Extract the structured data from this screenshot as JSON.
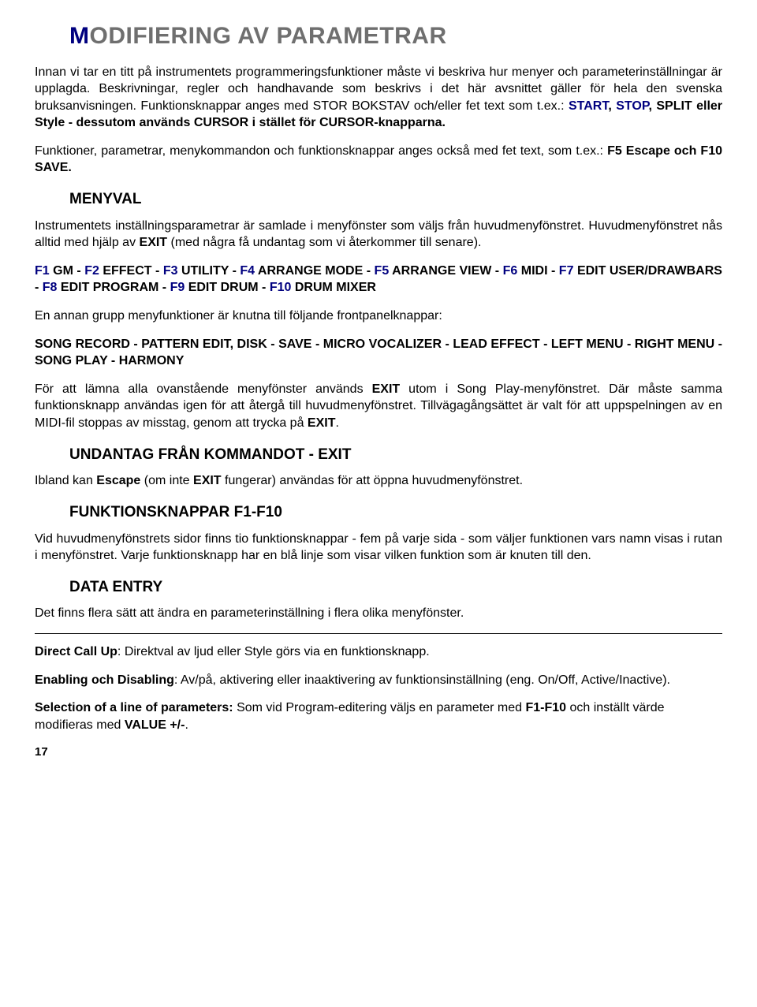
{
  "title": {
    "first": "M",
    "rest": "ODIFIERING AV  PARAMETRAR"
  },
  "p1a": "Innan vi tar en titt på instrumentets programmeringsfunktioner måste vi beskriva hur menyer och parameterinställningar är upplagda. Beskrivningar, regler och handhavande som beskrivs i det här avsnittet gäller för hela den svenska bruksanvisningen. Funktionsknappar anges med STOR BOKSTAV och/eller fet text som t.ex.: ",
  "p1_start": "START",
  "p1_c1": ", ",
  "p1_stop": "STOP",
  "p1_c2": ", ",
  "p1b": "SPLIT eller Style - dessutom används CURSOR i stället för CURSOR-knapparna.",
  "p2a": "Funktioner, parametrar, menykommandon och funktionsknappar anges också med fet text, som t.ex.: ",
  "p2b": "F5 Escape och F10 SAVE.",
  "h_menyval": "MENYVAL",
  "p3a": "Instrumentets inställningsparametrar är samlade i menyfönster som väljs från huvudmenyfönstret. Huvudmenyfönstret nås alltid med hjälp av ",
  "p3_exit": "EXIT",
  "p3b": "  (med några få undantag som vi återkommer till senare).",
  "menu": {
    "f1": "F1",
    "gm": "GM",
    "f2": "F2",
    "effect": "EFFECT",
    "f3": "F3",
    "utility": "UTILITY",
    "f4": "F4",
    "arrmode": "ARRANGE MODE",
    "f5": "F5",
    "arrview": "ARRANGE VIEW",
    "f6": "F6",
    "midi": "MIDI",
    "f7": "F7",
    "euser": "EDIT USER/DRAWBARS",
    "f8": "F8",
    "eprog": "EDIT PROGRAM",
    "f9": "F9",
    "edrum": "EDIT DRUM",
    "f10": "F10",
    "dmixer": "DRUM MIXER",
    "dash": " - "
  },
  "p4": "En annan grupp menyfunktioner är knutna till följande frontpanelknappar:",
  "p5": "SONG RECORD - PATTERN EDIT, DISK - SAVE - MICRO VOCALIZER - LEAD EFFECT - LEFT MENU - RIGHT MENU - SONG PLAY - HARMONY",
  "p6a": "För att lämna alla ovanstående menyfönster används ",
  "p6_exit1": "EXIT",
  "p6b": " utom i Song Play-menyfönstret. Där måste samma funktionsknapp användas igen för att återgå till huvudmenyfönstret. Tillvägagångsättet är valt för att uppspelningen av en MIDI-fil stoppas av misstag, genom att trycka på ",
  "p6_exit2": "EXIT",
  "p6c": ".",
  "h_undantag": "UNDANTAG FRÅN KOMMANDOT - EXIT",
  "p7a": "Ibland kan ",
  "p7_esc": "Escape",
  "p7b": " (om inte ",
  "p7_exit": "EXIT",
  "p7c": " fungerar) användas för att öppna huvudmenyfönstret.",
  "h_fknappar": "FUNKTIONSKNAPPAR F1-F10",
  "p8": "Vid huvudmenyfönstrets sidor finns tio funktionsknappar - fem på varje sida - som väljer funktionen vars namn visas i rutan i menyfönstret. Varje funktionsknapp har en blå linje som visar vilken funktion som är knuten till den.",
  "h_dataentry": "DATA ENTRY",
  "p9": "Det finns flera sätt att ändra en parameterinställning i flera olika menyfönster.",
  "p10a": "Direct Call Up",
  "p10b": ": Direktval av ljud eller Style görs via en funktionsknapp.",
  "p11a": "Enabling och Disabling",
  "p11b": ": Av/på, aktivering eller inaaktivering av  funktionsinställning (eng. On/Off, Active/Inactive).",
  "p12a": "Selection of a line of parameters:",
  "p12b": " Som vid Program-editering väljs en parameter med ",
  "p12c": "F1-F10",
  "p12d": " och inställt värde modifieras med ",
  "p12e": "VALUE +/-",
  "p12f": ".",
  "page": "17"
}
